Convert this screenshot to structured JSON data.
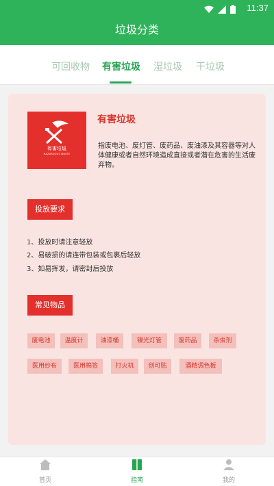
{
  "status_bar": {
    "time": "11:37",
    "icons": [
      "wifi-icon",
      "signal-icon",
      "battery-icon"
    ]
  },
  "header": {
    "title": "垃圾分类"
  },
  "tabs": [
    {
      "label": "可回收物",
      "active": false
    },
    {
      "label": "有害垃圾",
      "active": true
    },
    {
      "label": "湿垃圾",
      "active": false
    },
    {
      "label": "干垃圾",
      "active": false
    }
  ],
  "category": {
    "logo_text_cn": "有害垃圾",
    "logo_text_en": "HAZARDOUS WASTE",
    "title": "有害垃圾",
    "description": "指废电池、废灯管、废药品、废油漆及其容器等对人体健康或者自然环境造成直接或者潜在危害的生活废弃物。"
  },
  "requirements": {
    "title": "投放要求",
    "items": [
      "1、投放时请注意轻放",
      "2、易破损的请连带包装或包裹后轻放",
      "3、如易挥发，请密封后投放"
    ]
  },
  "common_items": {
    "title": "常见物品",
    "row1": [
      "废电池",
      "温度计",
      "油漆桶",
      "镍光灯管",
      "废药品",
      "杀虫剂"
    ],
    "row2": [
      "医用纱布",
      "医用棉签",
      "打火机",
      "创可贴",
      "酒精调色板"
    ]
  },
  "bottom_nav": [
    {
      "label": "首页",
      "icon": "home-icon",
      "active": false
    },
    {
      "label": "指南",
      "icon": "guide-icon",
      "active": true
    },
    {
      "label": "我的",
      "icon": "profile-icon",
      "active": false
    }
  ],
  "colors": {
    "primary_green": "#2fb35a",
    "accent_red": "#e4302c",
    "card_bg": "#fae4e1",
    "chip_bg": "#f3c0bc"
  }
}
